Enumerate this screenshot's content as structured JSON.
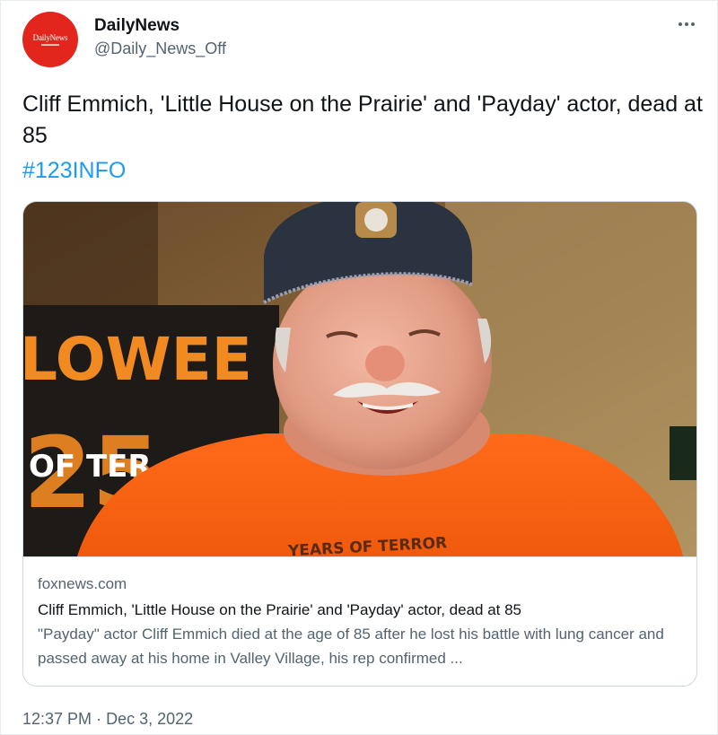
{
  "author": {
    "display_name": "DailyNews",
    "handle": "@Daily_News_Off",
    "avatar_text": "DailyNews",
    "avatar_color": "#e2261d"
  },
  "tweet": {
    "text": "Cliff Emmich, 'Little House on the Prairie' and 'Payday' actor, dead at 85",
    "hashtag": "#123INFO",
    "hashtag_color": "#1d9bf0"
  },
  "card": {
    "image_sign_text": "LOWEE",
    "image_sign_number": "25",
    "image_sign_subtext": "OF TER",
    "shirt_text": "YEARS OF TERROR",
    "domain": "foxnews.com",
    "title": "Cliff Emmich, 'Little House on the Prairie' and 'Payday' actor, dead at 85",
    "description": "\"Payday\" actor Cliff Emmich died at the age of 85 after he lost his battle with lung cancer and passed away at his home in Valley Village, his rep confirmed ..."
  },
  "meta": {
    "time": "12:37 PM",
    "separator": "·",
    "date": "Dec 3, 2022"
  },
  "icons": {
    "more": "more-horizontal-icon"
  }
}
